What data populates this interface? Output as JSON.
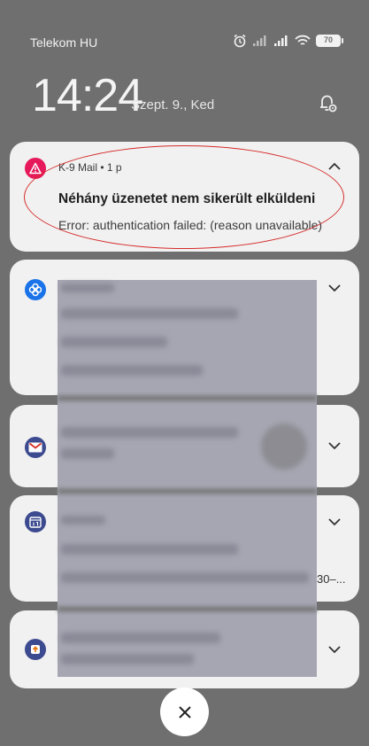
{
  "status_bar": {
    "carrier": "Telekom HU",
    "battery": "70",
    "icons": [
      "alarm-icon",
      "signal-icon",
      "signal-icon",
      "wifi-icon",
      "battery-icon"
    ]
  },
  "lockscreen": {
    "time": "14:24",
    "date": "Szept. 9., Ked"
  },
  "notifications": [
    {
      "app": "K-9 Mail",
      "header": "K-9 Mail • 1 p",
      "title": "Néhány üzenetet nem sikerült elküldeni",
      "body": "Error: authentication failed: (reason unavailable)",
      "accent": "#e6195b",
      "icon": "warning-icon",
      "expanded": true
    },
    {
      "icon": "pinwheel-icon",
      "accent": "#1a73e8",
      "blurred": true
    },
    {
      "icon": "gmail-icon",
      "accent": "#3c4a8f",
      "blurred": true
    },
    {
      "icon": "calendar-icon",
      "accent": "#3c4a8f",
      "blurred": true,
      "visible_fragment": "30–..."
    },
    {
      "icon": "upload-icon",
      "accent": "#3c4a8f",
      "blurred": true
    }
  ],
  "colors": {
    "background": "#6f6f6f",
    "card": "#f1f1f1",
    "annotation": "#d62b2b"
  }
}
